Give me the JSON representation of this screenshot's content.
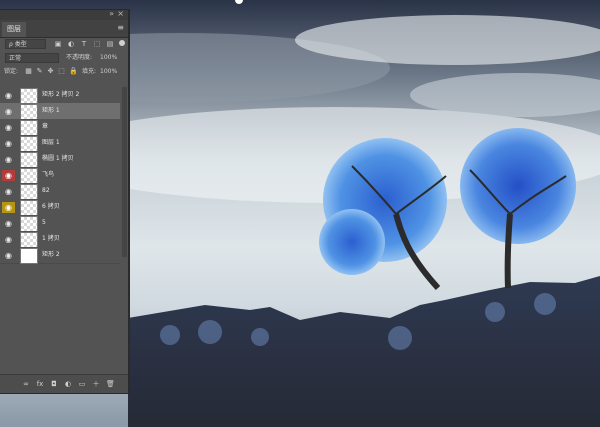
{
  "panel": {
    "tab_label": "图层",
    "filter_label": "ρ 类型",
    "blend_mode": "正常",
    "opacity_label": "不透明度:",
    "opacity_value": "100%",
    "lock_label": "锁定:",
    "fill_label": "填充:",
    "fill_value": "100%",
    "layers": [
      {
        "name": "矩形 2 拷贝 2",
        "eye": "normal",
        "selected": false,
        "thumb": "transparent"
      },
      {
        "name": "矩形 1",
        "eye": "normal",
        "selected": true,
        "thumb": "transparent"
      },
      {
        "name": "章",
        "eye": "normal",
        "selected": false,
        "thumb": "transparent"
      },
      {
        "name": "图层 1",
        "eye": "normal",
        "selected": false,
        "thumb": "transparent"
      },
      {
        "name": "椭圆 1 拷贝",
        "eye": "normal",
        "selected": false,
        "thumb": "transparent"
      },
      {
        "name": "飞鸟",
        "eye": "red",
        "selected": false,
        "thumb": "transparent"
      },
      {
        "name": "82",
        "eye": "normal",
        "selected": false,
        "thumb": "transparent"
      },
      {
        "name": "6 拷贝",
        "eye": "yellow",
        "selected": false,
        "thumb": "transparent"
      },
      {
        "name": "5",
        "eye": "normal",
        "selected": false,
        "thumb": "transparent"
      },
      {
        "name": "1 拷贝",
        "eye": "normal",
        "selected": false,
        "thumb": "transparent"
      },
      {
        "name": "矩形 2",
        "eye": "normal",
        "selected": false,
        "thumb": "white"
      }
    ]
  },
  "colors": {
    "panel_bg": "#535353",
    "selected_row": "#6f6f6f",
    "red_eye": "#b23b3b",
    "yellow_eye": "#b59512",
    "tree_blue": "#4e8fe0",
    "mountain": "#2f3c56"
  },
  "icons": {
    "eye": "eye-icon",
    "lock": "lock-icon",
    "search": "search-icon",
    "menu": "menu-icon"
  }
}
